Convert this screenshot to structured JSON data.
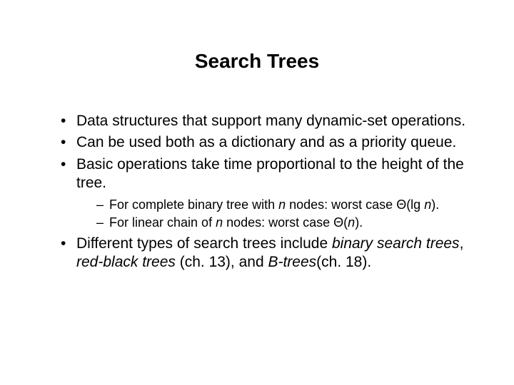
{
  "title": "Search Trees",
  "bullets": {
    "b1": "Data structures that support many dynamic-set operations.",
    "b2": "Can be used both as a dictionary and as a priority queue.",
    "b3": "Basic operations take time proportional to the height of the tree.",
    "b3_sub1_a": "For complete binary tree with ",
    "b3_sub1_n": "n",
    "b3_sub1_b": " nodes: worst case ",
    "b3_sub1_theta": "Θ(lg ",
    "b3_sub1_n2": "n",
    "b3_sub1_c": ").",
    "b3_sub2_a": "For linear chain of ",
    "b3_sub2_n": "n",
    "b3_sub2_b": " nodes: worst case ",
    "b3_sub2_theta": "Θ(",
    "b3_sub2_n2": "n",
    "b3_sub2_c": ").",
    "b4_a": "Different types of search trees include ",
    "b4_bst": "binary search trees",
    "b4_b": ", ",
    "b4_rbt": "red-black trees",
    "b4_c": " (ch. 13), and ",
    "b4_btrees": "B-trees",
    "b4_d": "(ch. 18)."
  }
}
